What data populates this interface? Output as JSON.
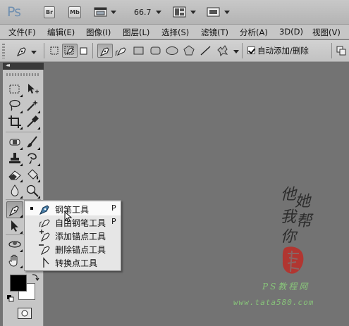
{
  "appbar": {
    "logo": "Ps",
    "bridge_label": "Br",
    "minibridge_label": "Mb",
    "zoom": "66.7"
  },
  "menu": {
    "items": [
      "文件(F)",
      "编辑(E)",
      "图像(I)",
      "图层(L)",
      "选择(S)",
      "滤镜(T)",
      "分析(A)",
      "3D(D)",
      "视图(V)"
    ]
  },
  "options": {
    "auto_add_delete_label": "自动添加/删除",
    "auto_add_delete_checked": true
  },
  "toolpanel": {
    "collapse_arrows": "◂◂",
    "foreground_color": "#000000",
    "background_color": "#ffffff"
  },
  "flyout": {
    "items": [
      {
        "label": "钢笔工具",
        "shortcut": "P",
        "icon": "pen-icon",
        "selected": true
      },
      {
        "label": "自由钢笔工具",
        "shortcut": "P",
        "icon": "freeform-pen-icon",
        "selected": false
      },
      {
        "label": "添加锚点工具",
        "shortcut": "",
        "icon": "add-anchor-point-icon",
        "selected": false
      },
      {
        "label": "删除锚点工具",
        "shortcut": "",
        "icon": "delete-anchor-point-icon",
        "selected": false
      },
      {
        "label": "转换点工具",
        "shortcut": "",
        "icon": "convert-point-icon",
        "selected": false
      }
    ]
  },
  "canvas": {
    "calligraphy": [
      "他",
      "她",
      "我",
      "帮",
      "你"
    ],
    "watermark_title": "PS教程网",
    "watermark_url": "www.tata580.com",
    "canvas_color": "#737373"
  }
}
